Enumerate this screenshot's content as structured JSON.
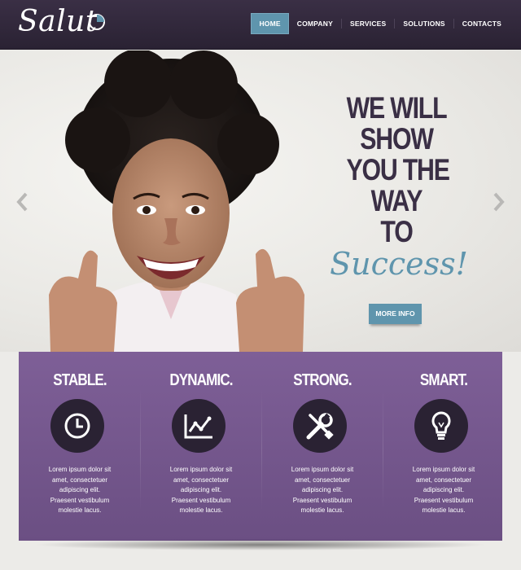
{
  "header": {
    "logo_text": "Salut",
    "nav": [
      "HOME",
      "COMPANY",
      "SERVICES",
      "SOLUTIONS",
      "CONTACTS"
    ],
    "active_nav": "HOME"
  },
  "hero": {
    "headline": [
      "WE WILL",
      "SHOW",
      "YOU THE",
      "WAY",
      "TO"
    ],
    "tagline": "Success!",
    "button_label": "MORE INFO"
  },
  "features": [
    {
      "title": "STABLE.",
      "icon": "clock-icon",
      "text": [
        "Lorem ipsum dolor sit",
        "amet, consectetuer",
        "adipiscing elit.",
        "Praesent vestibulum",
        "molestie lacus."
      ]
    },
    {
      "title": "DYNAMIC.",
      "icon": "chart-icon",
      "text": [
        "Lorem ipsum dolor sit",
        "amet, consectetuer",
        "adipiscing elit.",
        "Praesent vestibulum",
        "molestie lacus."
      ]
    },
    {
      "title": "STRONG.",
      "icon": "tools-icon",
      "text": [
        "Lorem ipsum dolor sit",
        "amet, consectetuer",
        "adipiscing elit.",
        "Praesent vestibulum",
        "molestie lacus."
      ]
    },
    {
      "title": "SMART.",
      "icon": "lightbulb-icon",
      "text": [
        "Lorem ipsum dolor sit",
        "amet, consectetuer",
        "adipiscing elit.",
        "Praesent vestibulum",
        "molestie lacus."
      ]
    }
  ],
  "colors": {
    "header_bg": "#2f2639",
    "accent_blue": "#5f95ad",
    "feature_purple": "#765a8e",
    "headline_dark": "#3a2f45"
  }
}
